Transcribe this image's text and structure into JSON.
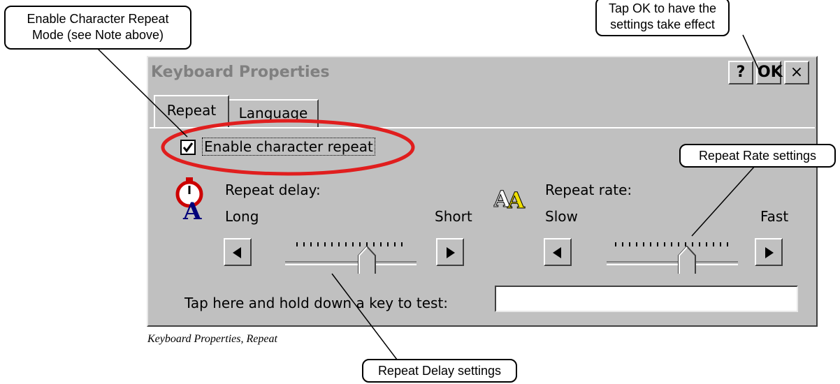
{
  "window": {
    "title": "Keyboard Properties",
    "help_label": "?",
    "ok_label": "OK",
    "close_label": "×"
  },
  "tabs": [
    {
      "label": "Repeat",
      "active": true
    },
    {
      "label": "Language",
      "active": false
    }
  ],
  "repeat": {
    "enable_label": "Enable character repeat",
    "enable_checked": true,
    "delay": {
      "label": "Repeat delay:",
      "min_label": "Long",
      "max_label": "Short",
      "icon": "stopwatch-icon",
      "value_fraction": 0.64
    },
    "rate": {
      "label": "Repeat rate:",
      "min_label": "Slow",
      "max_label": "Fast",
      "icon": "letters-aa-icon",
      "value_fraction": 0.64
    },
    "test_label": "Tap here and hold down a key to test:",
    "test_value": ""
  },
  "callouts": {
    "enable": [
      "Enable Character Repeat",
      "Mode (see Note above)"
    ],
    "ok": [
      "Tap OK to have the",
      "settings take effect"
    ],
    "rate": "Repeat Rate settings",
    "delay": "Repeat Delay settings"
  },
  "caption": "Keyboard Properties, Repeat",
  "colors": {
    "dialog_bg": "#c0c0c0",
    "highlight_ellipse": "#e01e1e"
  }
}
